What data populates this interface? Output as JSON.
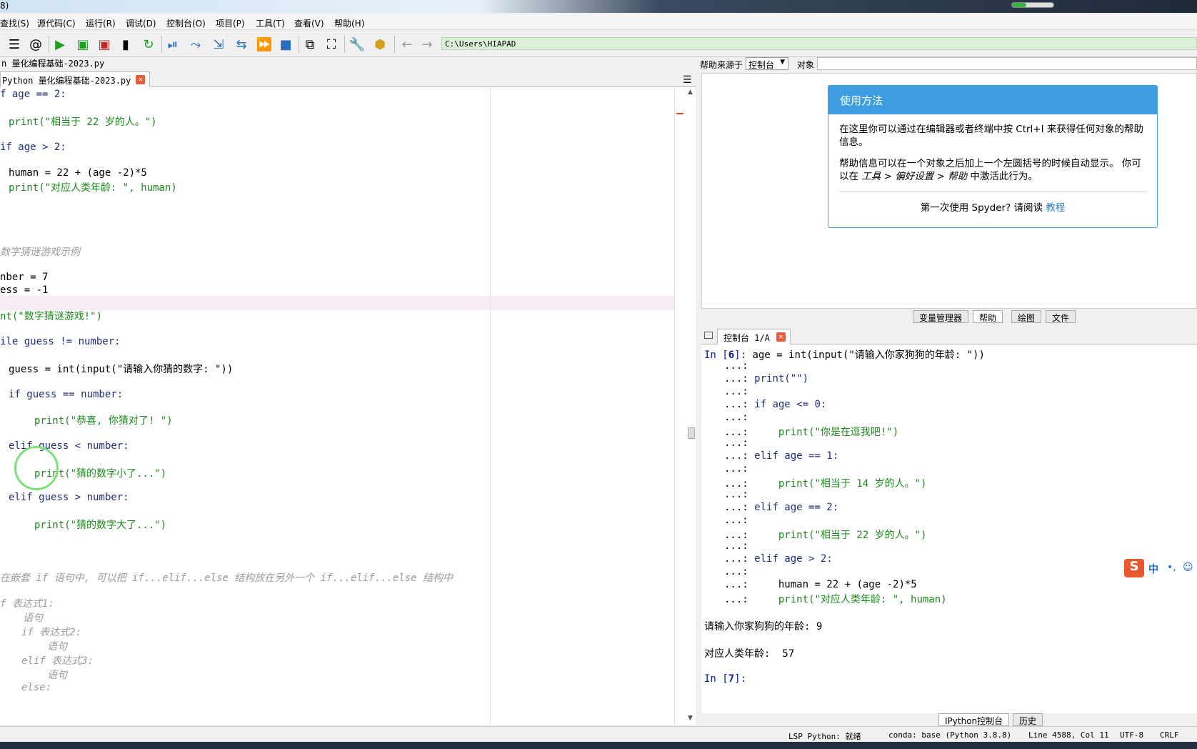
{
  "window": {
    "title_fragment": "8)"
  },
  "menu": [
    "查找(S)",
    "源代码(C)",
    "运行(R)",
    "调试(D)",
    "控制台(O)",
    "项目(P)",
    "工具(T)",
    "查看(V)",
    "帮助(H)"
  ],
  "toolbar": {
    "path": "C:\\Users\\HIAPAD"
  },
  "editor": {
    "file_path_fragment": "n 量化编程基础-2023.py",
    "tab_label": "Python 量化编程基础-2023.py",
    "lines": [
      "f age == 2:",
      "print(\"相当于 22 岁的人。\")",
      "if age > 2:",
      "human = 22 + (age -2)*5",
      "print(\"对应人类年龄: \", human)",
      "数字猜谜游戏示例",
      "nber = 7",
      "ess = -1",
      "nt(\"数字猜谜游戏!\")",
      "ile guess != number:",
      "guess = int(input(\"请输入你猜的数字: \"))",
      "if guess == number:",
      "print(\"恭喜, 你猜对了! \")",
      "elif guess < number:",
      "print(\"猜的数字小了...\")",
      "elif guess > number:",
      "print(\"猜的数字大了...\")",
      "在嵌套 if 语句中, 可以把 if...elif...else 结构放在另外一个 if...elif...else 结构中",
      "f 表达式1:",
      "语句",
      "if 表达式2:",
      "语句",
      "elif 表达式3:",
      "语句",
      "else:"
    ]
  },
  "help": {
    "source_label": "帮助来源于",
    "source_value": "控制台",
    "object_label": "对象",
    "card_title": "使用方法",
    "para1": "在这里你可以通过在编辑器或者终端中按 Ctrl+I 来获得任何对象的帮助信息。",
    "para2_a": "帮助信息可以在一个对象之后加上一个左圆括号的时候自动显示。 你可以在 ",
    "para2_b": "工具 > 偏好设置 > 帮助",
    "para2_c": " 中激活此行为。",
    "footer_text": "第一次使用 Spyder? 请阅读 ",
    "footer_link": "教程"
  },
  "pane_tabs": [
    "变量管理器",
    "帮助",
    "绘图",
    "文件"
  ],
  "console": {
    "tab_label": "控制台 1/A",
    "in_prompt": "In [",
    "in_close": "]: ",
    "cont": "...:",
    "in6": "6",
    "in7": "7",
    "l1": "age = int(input(\"请输入你家狗狗的年龄: \"))",
    "l2": "print(\"\")",
    "l3": "if age <= 0:",
    "l4": "print(\"你是在逗我吧!\")",
    "l5": "elif age == 1:",
    "l6": "print(\"相当于 14 岁的人。\")",
    "l7": "elif age == 2:",
    "l8": "print(\"相当于 22 岁的人。\")",
    "l9": "elif age > 2:",
    "l10": "human = 22 + (age -2)*5",
    "l11": "print(\"对应人类年龄: \", human)",
    "out1": "请输入你家狗狗的年龄: 9",
    "out2": "对应人类年龄:  57"
  },
  "console_bottom_tabs": [
    "IPython控制台",
    "历史"
  ],
  "ime": {
    "zh": "中"
  },
  "status": {
    "lsp": "LSP Python: 就绪",
    "conda": "conda: base (Python 3.8.8)",
    "position": "Line 4588, Col 11",
    "encoding": "UTF-8",
    "eol": "CRLF"
  },
  "colors": {
    "accent": "#3d9de0",
    "run_green": "#1aa31a",
    "string_green": "#1a8a1a",
    "keyword_blue": "#1f2d7a"
  }
}
